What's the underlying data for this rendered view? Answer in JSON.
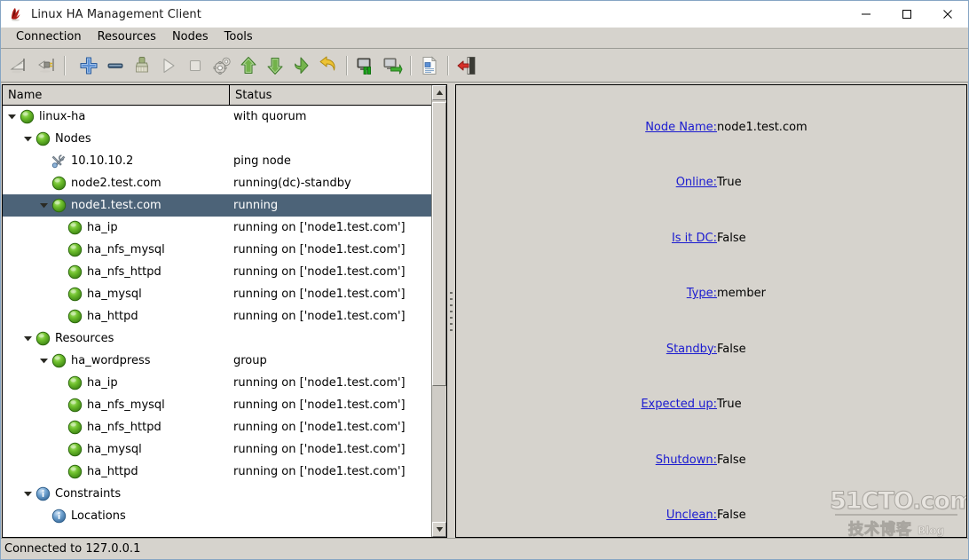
{
  "window": {
    "title": "Linux HA Management Client",
    "icon": "app-logo-icon",
    "minimize_label": "−",
    "maximize_label": "□",
    "close_label": "×"
  },
  "menubar": {
    "items": [
      {
        "label": "Connection"
      },
      {
        "label": "Resources"
      },
      {
        "label": "Nodes"
      },
      {
        "label": "Tools"
      }
    ]
  },
  "toolbar": {
    "buttons": [
      {
        "name": "connect-icon",
        "tip": "Connect"
      },
      {
        "name": "disconnect-plug-icon",
        "tip": "Disconnect"
      },
      {
        "sep": true
      },
      {
        "name": "add-plus-icon",
        "tip": "Add"
      },
      {
        "name": "remove-minus-icon",
        "tip": "Remove"
      },
      {
        "name": "cleanup-brush-icon",
        "tip": "Cleanup"
      },
      {
        "name": "start-play-icon",
        "tip": "Start"
      },
      {
        "name": "stop-square-icon",
        "tip": "Stop"
      },
      {
        "name": "settings-gears-icon",
        "tip": "Manage"
      },
      {
        "name": "move-up-arrow-icon",
        "tip": "Move up"
      },
      {
        "name": "move-down-arrow-icon",
        "tip": "Move down"
      },
      {
        "name": "migrate-arrow-icon",
        "tip": "Migrate"
      },
      {
        "name": "undo-arrow-icon",
        "tip": "Undo"
      },
      {
        "sep": true
      },
      {
        "name": "standby-node-icon",
        "tip": "Standby"
      },
      {
        "name": "activate-node-icon",
        "tip": "Activate"
      },
      {
        "sep": true
      },
      {
        "name": "document-icon",
        "tip": "Document"
      },
      {
        "sep": true
      },
      {
        "name": "exit-door-icon",
        "tip": "Exit"
      }
    ]
  },
  "tree": {
    "columns": {
      "name": "Name",
      "status": "Status"
    },
    "rows": [
      {
        "indent": 0,
        "twisty": "open",
        "icon": "green-ball-icon",
        "name": "linux-ha",
        "status": "with quorum",
        "selected": false
      },
      {
        "indent": 1,
        "twisty": "open",
        "icon": "green-ball-icon",
        "name": "Nodes",
        "status": "",
        "selected": false
      },
      {
        "indent": 2,
        "twisty": "none",
        "icon": "tools-icon",
        "name": "10.10.10.2",
        "status": "ping node",
        "selected": false
      },
      {
        "indent": 2,
        "twisty": "none",
        "icon": "green-ball-icon",
        "name": "node2.test.com",
        "status": "running(dc)-standby",
        "selected": false
      },
      {
        "indent": 2,
        "twisty": "open",
        "icon": "green-ball-icon",
        "name": "node1.test.com",
        "status": "running",
        "selected": true
      },
      {
        "indent": 3,
        "twisty": "none",
        "icon": "green-ball-icon",
        "name": "ha_ip",
        "status": "running on ['node1.test.com']",
        "selected": false
      },
      {
        "indent": 3,
        "twisty": "none",
        "icon": "green-ball-icon",
        "name": "ha_nfs_mysql",
        "status": "running on ['node1.test.com']",
        "selected": false
      },
      {
        "indent": 3,
        "twisty": "none",
        "icon": "green-ball-icon",
        "name": "ha_nfs_httpd",
        "status": "running on ['node1.test.com']",
        "selected": false
      },
      {
        "indent": 3,
        "twisty": "none",
        "icon": "green-ball-icon",
        "name": "ha_mysql",
        "status": "running on ['node1.test.com']",
        "selected": false
      },
      {
        "indent": 3,
        "twisty": "none",
        "icon": "green-ball-icon",
        "name": "ha_httpd",
        "status": "running on ['node1.test.com']",
        "selected": false
      },
      {
        "indent": 1,
        "twisty": "open",
        "icon": "green-ball-icon",
        "name": "Resources",
        "status": "",
        "selected": false
      },
      {
        "indent": 2,
        "twisty": "open",
        "icon": "green-ball-icon",
        "name": "ha_wordpress",
        "status": "group",
        "selected": false
      },
      {
        "indent": 3,
        "twisty": "none",
        "icon": "green-ball-icon",
        "name": "ha_ip",
        "status": "running on ['node1.test.com']",
        "selected": false
      },
      {
        "indent": 3,
        "twisty": "none",
        "icon": "green-ball-icon",
        "name": "ha_nfs_mysql",
        "status": "running on ['node1.test.com']",
        "selected": false
      },
      {
        "indent": 3,
        "twisty": "none",
        "icon": "green-ball-icon",
        "name": "ha_nfs_httpd",
        "status": "running on ['node1.test.com']",
        "selected": false
      },
      {
        "indent": 3,
        "twisty": "none",
        "icon": "green-ball-icon",
        "name": "ha_mysql",
        "status": "running on ['node1.test.com']",
        "selected": false
      },
      {
        "indent": 3,
        "twisty": "none",
        "icon": "green-ball-icon",
        "name": "ha_httpd",
        "status": "running on ['node1.test.com']",
        "selected": false
      },
      {
        "indent": 1,
        "twisty": "open",
        "icon": "info-icon",
        "name": "Constraints",
        "status": "",
        "selected": false
      },
      {
        "indent": 2,
        "twisty": "none",
        "icon": "info-icon",
        "name": "Locations",
        "status": "",
        "selected": false
      }
    ]
  },
  "details": {
    "fields": [
      {
        "label": "Node Name:",
        "value": "node1.test.com"
      },
      {
        "label": "Online:",
        "value": "True"
      },
      {
        "label": "Is it DC:",
        "value": "False"
      },
      {
        "label": "Type:",
        "value": "member"
      },
      {
        "label": "Standby:",
        "value": "False"
      },
      {
        "label": "Expected up:",
        "value": "True"
      },
      {
        "label": "Shutdown:",
        "value": "False"
      },
      {
        "label": "Unclean:",
        "value": "False"
      }
    ]
  },
  "watermark": {
    "line1": "51CTO.com",
    "line2": "技术博客",
    "line3": "Blog"
  },
  "statusbar": {
    "text": "Connected to 127.0.0.1"
  },
  "colors": {
    "selection": "#4c6378",
    "link": "#1a1ad0",
    "chrome": "#d6d3cd",
    "node_green": "#5eb62c"
  }
}
